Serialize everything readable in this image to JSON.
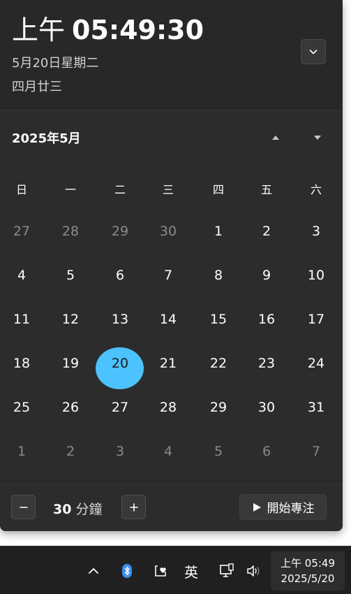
{
  "header": {
    "ampm": "上午",
    "time": "05:49:30",
    "date": "5月20日星期二",
    "lunar": "四月廿三"
  },
  "calendar": {
    "month_title": "2025年5月",
    "weekdays": [
      "日",
      "一",
      "二",
      "三",
      "四",
      "五",
      "六"
    ],
    "weeks": [
      [
        {
          "d": "27",
          "other": true
        },
        {
          "d": "28",
          "other": true
        },
        {
          "d": "29",
          "other": true
        },
        {
          "d": "30",
          "other": true
        },
        {
          "d": "1"
        },
        {
          "d": "2"
        },
        {
          "d": "3"
        }
      ],
      [
        {
          "d": "4"
        },
        {
          "d": "5"
        },
        {
          "d": "6"
        },
        {
          "d": "7"
        },
        {
          "d": "8"
        },
        {
          "d": "9"
        },
        {
          "d": "10"
        }
      ],
      [
        {
          "d": "11"
        },
        {
          "d": "12"
        },
        {
          "d": "13"
        },
        {
          "d": "14"
        },
        {
          "d": "15"
        },
        {
          "d": "16"
        },
        {
          "d": "17"
        }
      ],
      [
        {
          "d": "18"
        },
        {
          "d": "19"
        },
        {
          "d": "20",
          "today": true
        },
        {
          "d": "21"
        },
        {
          "d": "22"
        },
        {
          "d": "23"
        },
        {
          "d": "24"
        }
      ],
      [
        {
          "d": "25"
        },
        {
          "d": "26"
        },
        {
          "d": "27"
        },
        {
          "d": "28"
        },
        {
          "d": "29"
        },
        {
          "d": "30"
        },
        {
          "d": "31"
        }
      ],
      [
        {
          "d": "1",
          "other": true
        },
        {
          "d": "2",
          "other": true
        },
        {
          "d": "3",
          "other": true
        },
        {
          "d": "4",
          "other": true
        },
        {
          "d": "5",
          "other": true
        },
        {
          "d": "6",
          "other": true
        },
        {
          "d": "7",
          "other": true
        }
      ]
    ]
  },
  "focus": {
    "minutes": "30",
    "unit": "分鐘",
    "start_label": "開始專注"
  },
  "taskbar": {
    "ime_label": "英",
    "time": "上午 05:49",
    "date": "2025/5/20"
  },
  "colors": {
    "accent": "#4cc2ff",
    "flyout_bg": "#2c2c2c",
    "taskbar_bg": "#202020",
    "bluetooth": "#3a8ef6"
  },
  "icons": {
    "collapse": "chevron-down-icon",
    "prev_month": "triangle-up-icon",
    "next_month": "triangle-down-icon",
    "minus": "minus-icon",
    "plus": "plus-icon",
    "play": "play-icon",
    "tray": [
      "chevron-up-icon",
      "bluetooth-icon",
      "health-icon",
      "ime-icon",
      "network-icon",
      "volume-icon"
    ]
  }
}
